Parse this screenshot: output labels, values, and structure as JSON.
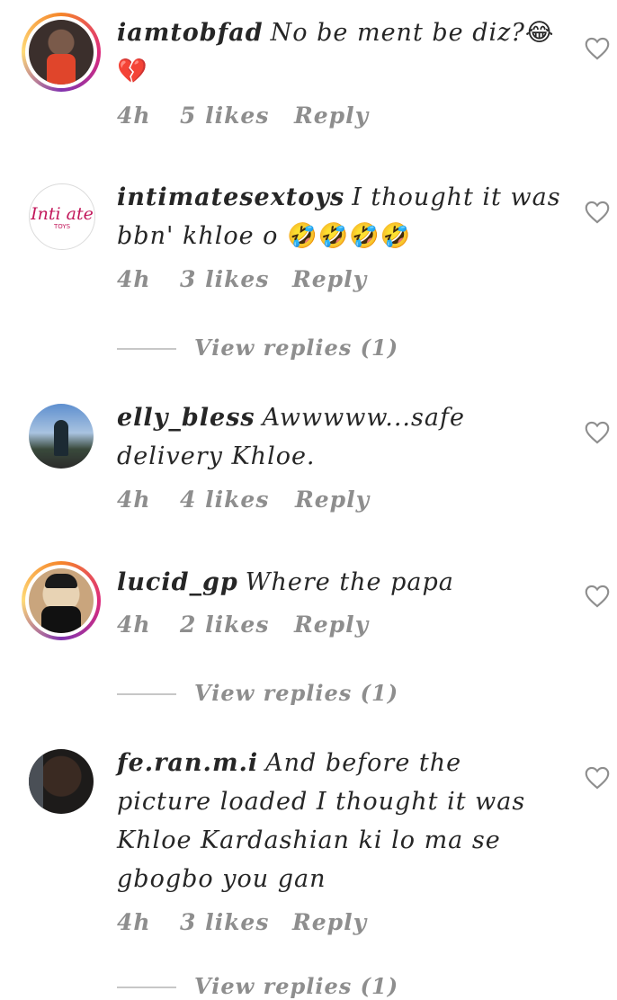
{
  "comments": [
    {
      "username": "iamtobfad",
      "text": "No be ment be diz?",
      "emoji": "😂💔",
      "time": "4h",
      "likes": "5 likes",
      "reply": "Reply"
    },
    {
      "username": "intimatesextoys",
      "text": "I thought it was bbn' khloe o",
      "emoji": "🤣🤣🤣🤣",
      "time": "4h",
      "likes": "3 likes",
      "reply": "Reply",
      "avatar_text": "Inti ate",
      "avatar_subtext": "TOYS"
    },
    {
      "username": "elly_bless",
      "text": "Awwwww...safe delivery Khloe.",
      "time": "4h",
      "likes": "4 likes",
      "reply": "Reply"
    },
    {
      "username": "lucid_gp",
      "text": "Where the papa",
      "time": "4h",
      "likes": "2 likes",
      "reply": "Reply"
    },
    {
      "username": "fe.ran.m.i",
      "text": "And before the picture loaded I thought it was Khloe Kardashian ki lo ma se gbogbo you gan",
      "time": "4h",
      "likes": "3 likes",
      "reply": "Reply"
    }
  ],
  "view_replies": [
    "View replies (1)",
    "View replies (1)",
    "View replies (1)"
  ],
  "colors": {
    "text": "#262626",
    "meta": "#8e8e8e",
    "story_ring": "#dd2a7b"
  },
  "icons": [
    "heart-icon"
  ]
}
